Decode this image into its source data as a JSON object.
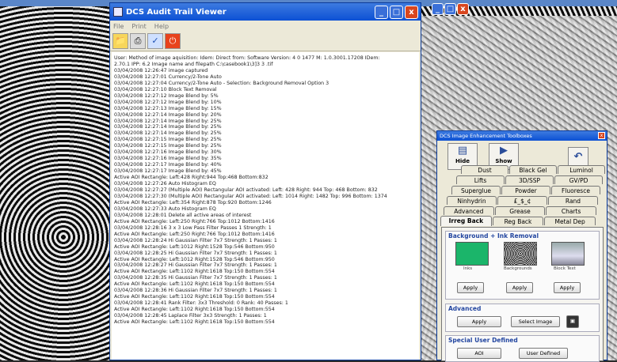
{
  "audit_window": {
    "title": "DCS Audit Trail Viewer",
    "menu": [
      "File",
      "Print",
      "Help"
    ],
    "controls": {
      "minimize": "_",
      "maximize": "□",
      "close": "x"
    },
    "toolbar_icons": [
      "open-folder-icon",
      "print-icon",
      "help-icon",
      "exit-icon"
    ],
    "log_lines": [
      "User:   Method of image aquisition:  Idem: Direct from:    Software Version: 4 0 1477  M:  1.0.3001.17208  IDem:",
      "2.70.1  IPP: 6.2  Image name and filepath  C:\\casebook1\\3]3 3   .tif",
      "03/04/2008  12:26:47  image captured",
      "03/04/2008  12:27:01  Currency/2-Tone Auto",
      "03/04/2008  12:27:04  Currency/2-Tone Auto - Selection: Background Removal Option 3",
      "03/04/2008  12:27:10  Block Text Removal",
      "03/04/2008  12:27:12  Image Blend by:  5%",
      "03/04/2008  12:27:12  Image Blend by:  10%",
      "03/04/2008  12:27:13  Image Blend by:  15%",
      "03/04/2008  12:27:14  Image Blend by:  20%",
      "03/04/2008  12:27:14  Image Blend by:  25%",
      "03/04/2008  12:27:14  Image Blend by:  25%",
      "03/04/2008  12:27:14  Image Blend by:  25%",
      "03/04/2008  12:27:15  Image Blend by:  25%",
      "03/04/2008  12:27:15  Image Blend by:  25%",
      "03/04/2008  12:27:16  Image Blend by:  30%",
      "03/04/2008  12:27:16  Image Blend by:  35%",
      "03/04/2008  12:27:17  Image Blend by:  40%",
      "03/04/2008  12:27:17  Image Blend by:  45%",
      "Active AOI Rectangle: Left:428 Right:944 Top:468 Bottom:832",
      "03/04/2008  12:27:26  Auto Histogram EQ",
      "03/04/2008  12:27:27  (Multiple AOI) Rectangular AOI activated:  Left: 428 Right: 944 Top: 468 Bottom: 832",
      "03/04/2008  12:27:30  (Multiple AOI) Rectangular AOI activated:  Left: 1014 Right: 1482 Top: 996 Bottom: 1374",
      "Active AOI Rectangle: Left:354 Right:878 Top:920 Bottom:1246",
      "03/04/2008  12:27:33  Auto Histogram EQ",
      "03/04/2008  12:28:01  Delete all active areas of interest",
      "Active AOI Rectangle: Left:250 Right:766 Top:1012 Bottom:1416",
      "03/04/2008  12:28:16  3 x 3 Low Pass Filter Passes 1 Strength: 1",
      "Active AOI Rectangle: Left:250 Right:766 Top:1012 Bottom:1416",
      "03/04/2008  12:28:24  Hi Gaussian Filter 7x7 Strength: 1 Passes:  1",
      "Active AOI Rectangle: Left:1012 Right:1528 Top:546 Bottom:950",
      "03/04/2008  12:28:25  Hi Gaussian Filter 7x7 Strength: 1 Passes:  1",
      "Active AOI Rectangle: Left:1012 Right:1528 Top:546 Bottom:950",
      "03/04/2008  12:28:27  Hi Gaussian Filter 7x7 Strength: 1 Passes:  1",
      "Active AOI Rectangle: Left:1102 Right:1618 Top:150 Bottom:554",
      "03/04/2008  12:28:35  Hi Gaussian Filter 7x7 Strength: 1 Passes:  1",
      "Active AOI Rectangle: Left:1102 Right:1618 Top:150 Bottom:554",
      "03/04/2008  12:28:36  Hi Gaussian Filter 7x7 Strength: 1 Passes:  1",
      "Active AOI Rectangle: Left:1102 Right:1618 Top:150 Bottom:554",
      "03/04/2008  12:28:41  Rank Filter: 3x3 Threshold: 0 Rank: 40 Passes: 1",
      "Active AOI Rectangle: Left:1102 Right:1618 Top:150 Bottom:554",
      "03/04/2008  12:28:45  Laplace Filter 3x3 Strength: 1 Passes: 1",
      "Active AOI Rectangle: Left:1102 Right:1618 Top:150 Bottom:554"
    ]
  },
  "back_window": {
    "controls": {
      "minimize": "_",
      "maximize": "□",
      "close": "x"
    }
  },
  "toolbox": {
    "title": "DCS Image Enhancement Toolboxes",
    "close": "x",
    "hide_label": "Hide",
    "show_label": "Show",
    "tabs_row1": [
      "Dust",
      "Black Gel",
      "Luminol"
    ],
    "tabs_row2": [
      "Lifts",
      "3D/SSP",
      "GV/PD"
    ],
    "tabs_row3": [
      "Superglue",
      "Powder",
      "Fluoresce"
    ],
    "tabs_row4": [
      "Ninhydrin",
      "£_$_¢",
      "Rand"
    ],
    "tabs_row5": [
      "Advanced",
      "Grease",
      "Charts"
    ],
    "tabs_row6": [
      "Irreg Back",
      "Reg Back",
      "Metal Dep"
    ],
    "bg_ink_title": "Background + Ink Removal",
    "thumb_labels": [
      "Inks",
      "Backgrounds",
      "Block Text"
    ],
    "apply_label": "Apply",
    "advanced_title": "Advanced",
    "select_image_label": "Select Image",
    "special_title": "Special User Defined",
    "aoi_label": "AOI",
    "user_defined_label": "User Defined"
  },
  "colors": {
    "titlebar": "#0c50d4",
    "close": "#d8461f",
    "group_title": "#2346a0"
  }
}
